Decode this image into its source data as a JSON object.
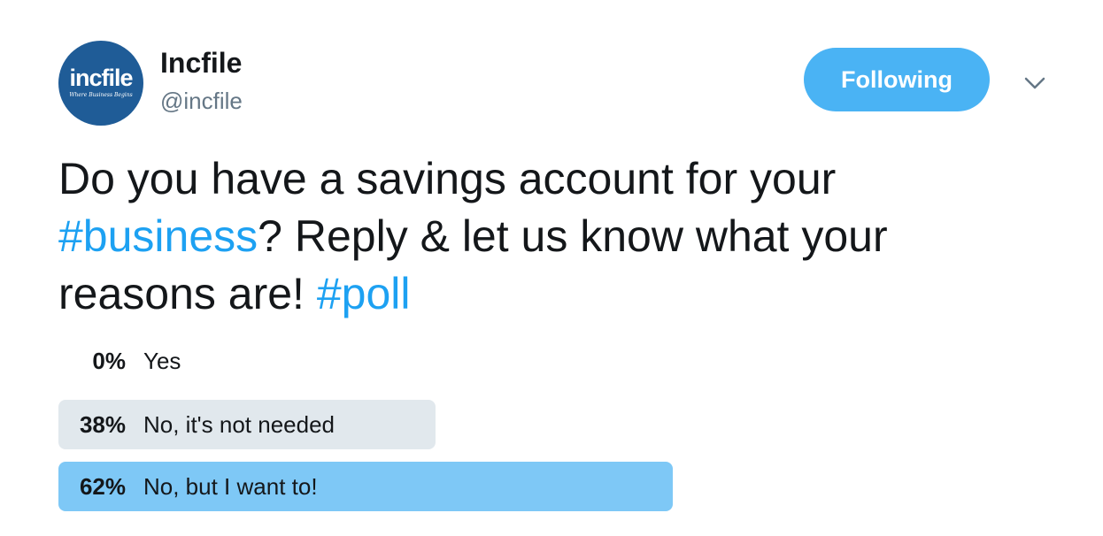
{
  "author": {
    "display_name": "Incfile",
    "handle": "@incfile",
    "avatar_logo_text": "incfile",
    "avatar_tagline": "Where Business Begins"
  },
  "follow_button": {
    "label": "Following"
  },
  "tweet": {
    "text_part1": "Do you have a savings account for your ",
    "hashtag1": "#business",
    "text_part2": "? Reply & let us know what your reasons are! ",
    "hashtag2": "#poll"
  },
  "poll": {
    "options": [
      {
        "percent": "0%",
        "label": "Yes",
        "fraction": 0.0,
        "bar_color": "#ffffff"
      },
      {
        "percent": "38%",
        "label": "No, it's not needed",
        "fraction": 0.38,
        "bar_color": "#e1e8ed"
      },
      {
        "percent": "62%",
        "label": "No, but I want to!",
        "fraction": 0.62,
        "bar_color": "#7ec8f6"
      }
    ]
  },
  "colors": {
    "brand_blue": "#1da1f2",
    "follow_button_bg": "#4ab3f4",
    "avatar_bg": "#1f5c97"
  },
  "icons": {
    "caret": "chevron-down-icon"
  }
}
